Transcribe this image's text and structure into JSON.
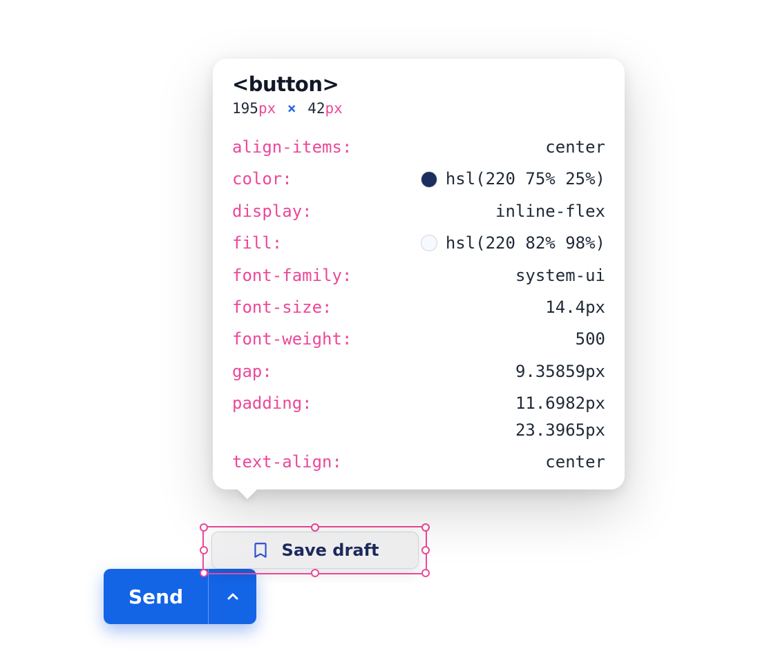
{
  "inspector": {
    "element_tag": "<button>",
    "dimensions": {
      "width": "195",
      "width_unit": "px",
      "sep": "×",
      "height": "42",
      "height_unit": "px"
    },
    "properties": [
      {
        "name": "align-items",
        "value": "center"
      },
      {
        "name": "color",
        "value": "hsl(220 75% 25%)",
        "swatch": "#1c2e5e"
      },
      {
        "name": "display",
        "value": "inline-flex"
      },
      {
        "name": "fill",
        "value": "hsl(220 82% 98%)",
        "swatch": "#f6f9fe"
      },
      {
        "name": "font-family",
        "value": "system-ui"
      },
      {
        "name": "font-size",
        "value": "14.4px"
      },
      {
        "name": "font-weight",
        "value": "500"
      },
      {
        "name": "gap",
        "value": "9.35859px"
      },
      {
        "name": "padding",
        "value": "11.6982px",
        "value2": "23.3965px"
      },
      {
        "name": "text-align",
        "value": "center"
      }
    ]
  },
  "buttons": {
    "save_draft_label": "Save draft",
    "send_label": "Send"
  },
  "icons": {
    "bookmark": "bookmark-icon",
    "chevron_up": "chevron-up-icon"
  },
  "colors": {
    "primary": "#1464e6",
    "selection": "#ec4899",
    "prop_name": "#ec4899"
  }
}
